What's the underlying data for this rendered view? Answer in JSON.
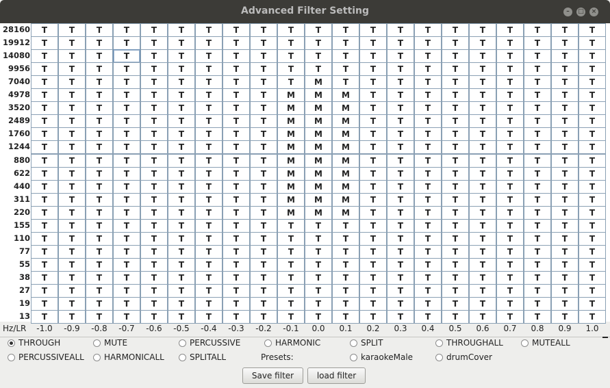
{
  "window": {
    "title": "Advanced Filter Setting"
  },
  "grid": {
    "corner_label": "Hz/LR",
    "row_labels": [
      "28160",
      "19912",
      "14080",
      "9956",
      "7040",
      "4978",
      "3520",
      "2489",
      "1760",
      "1244",
      "880",
      "622",
      "440",
      "311",
      "220",
      "155",
      "110",
      "77",
      "55",
      "38",
      "27",
      "19",
      "13"
    ],
    "col_labels": [
      "-1.0",
      "-0.9",
      "-0.8",
      "-0.7",
      "-0.6",
      "-0.5",
      "-0.4",
      "-0.3",
      "-0.2",
      "-0.1",
      "0.0",
      "0.1",
      "0.2",
      "0.3",
      "0.4",
      "0.5",
      "0.6",
      "0.7",
      "0.8",
      "0.9",
      "1.0"
    ],
    "cells": [
      "TTTTTTTTTTTTTTTTTTTTT",
      "TTTTTTTTTTTTTTTTTTTTT",
      "TTTTTTTTTTTTTTTTTTTTT",
      "TTTTTTTTTTTTTTTTTTTTT",
      "TTTTTTTTTTMTTTTTTTTTT",
      "TTTTTTTTTMMMTTTTTTTTT",
      "TTTTTTTTTMMMTTTTTTTTT",
      "TTTTTTTTTMMMTTTTTTTTT",
      "TTTTTTTTTMMMTTTTTTTTT",
      "TTTTTTTTTMMMTTTTTTTTT",
      "TTTTTTTTTMMMTTTTTTTTT",
      "TTTTTTTTTMMMTTTTTTTTT",
      "TTTTTTTTTMMMTTTTTTTTT",
      "TTTTTTTTTMMMTTTTTTTTT",
      "TTTTTTTTTMMMTTTTTTTTT",
      "TTTTTTTTTTTTTTTTTTTTT",
      "TTTTTTTTTTTTTTTTTTTTT",
      "TTTTTTTTTTTTTTTTTTTTT",
      "TTTTTTTTTTTTTTTTTTTTT",
      "TTTTTTTTTTTTTTTTTTTTT",
      "TTTTTTTTTTTTTTTTTTTTT",
      "TTTTTTTTTTTTTTTTTTTTT",
      "TTTTTTTTTTTTTTTTTTTTT"
    ],
    "selected_cell": {
      "row": 2,
      "col": 3
    }
  },
  "modes": {
    "selected": "THROUGH",
    "options": [
      "THROUGH",
      "MUTE",
      "PERCUSSIVE",
      "HARMONIC",
      "SPLIT",
      "THROUGHALL",
      "MUTEALL",
      "PERCUSSIVEALL",
      "HARMONICALL",
      "SPLITALL"
    ]
  },
  "presets": {
    "label": "Presets:",
    "options": [
      "karaokeMale",
      "drumCover"
    ],
    "selected": null
  },
  "buttons": {
    "save": "Save filter",
    "load": "load filter"
  }
}
